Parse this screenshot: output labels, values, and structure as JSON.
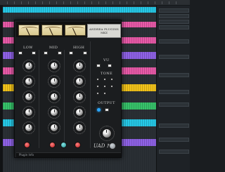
{
  "plugin": {
    "brand_line1": "ANDREA PLUGINS",
    "brand_line2": "MKZ",
    "eq_columns": [
      "LOW",
      "MID",
      "HIGH"
    ],
    "sections": {
      "vu": "VU",
      "tone": "TONE",
      "output": "OUTPUT"
    },
    "logo_text": "UAD ℕ",
    "bottom_label": "Plugin Info"
  },
  "colors": {
    "track_cyan": "#26c8e6",
    "track_pink": "#e85aa8",
    "track_yellow": "#f2c31a",
    "track_green": "#37c26a",
    "track_purple": "#8f62e6",
    "led_blue": "#2aa7ff",
    "button_red": "#c0392b",
    "button_teal": "#2aa6a6"
  },
  "icons": {
    "meter": "vu-meter-icon",
    "power": "power-icon"
  }
}
